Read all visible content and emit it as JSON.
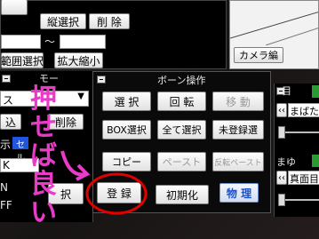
{
  "top_panel": {
    "btn_a_partial": "",
    "btn_vertical_select": "縦選択",
    "btn_delete": "削 除",
    "tilde": "～",
    "btn_range_select": "範囲選択",
    "btn_zoom": "拡大縮小"
  },
  "camera_panel": {
    "tab_label": "カメラ編"
  },
  "left_panel": {
    "header_partial": "モー",
    "dropdown_partial": "ス",
    "btn_insert_partial": "込",
    "btn_delete_partial": "削除",
    "label_show_partial": "示",
    "badge_partial": "セル",
    "field_k_partial": "K",
    "label_n": "N",
    "label_ff": "FF",
    "btn_partial_right": "択"
  },
  "bone_panel": {
    "title": "ボーン操作",
    "buttons": {
      "select": "選 択",
      "rotate": "回 転",
      "move": "移 動",
      "box_select": "BOX選択",
      "select_all": "全て選択",
      "unregistered_select": "未登録選",
      "copy": "コピー",
      "paste": "ペースト",
      "reverse_paste": "反転ペースト",
      "register": "登 録",
      "initialize": "初期化",
      "physics": "物 理"
    }
  },
  "right_panel": {
    "eyes_label": "目",
    "blink_label": "まばた",
    "mouth_label": "まゆ",
    "serious_label": "真面目"
  },
  "annotation": {
    "text": "押せば良い"
  }
}
